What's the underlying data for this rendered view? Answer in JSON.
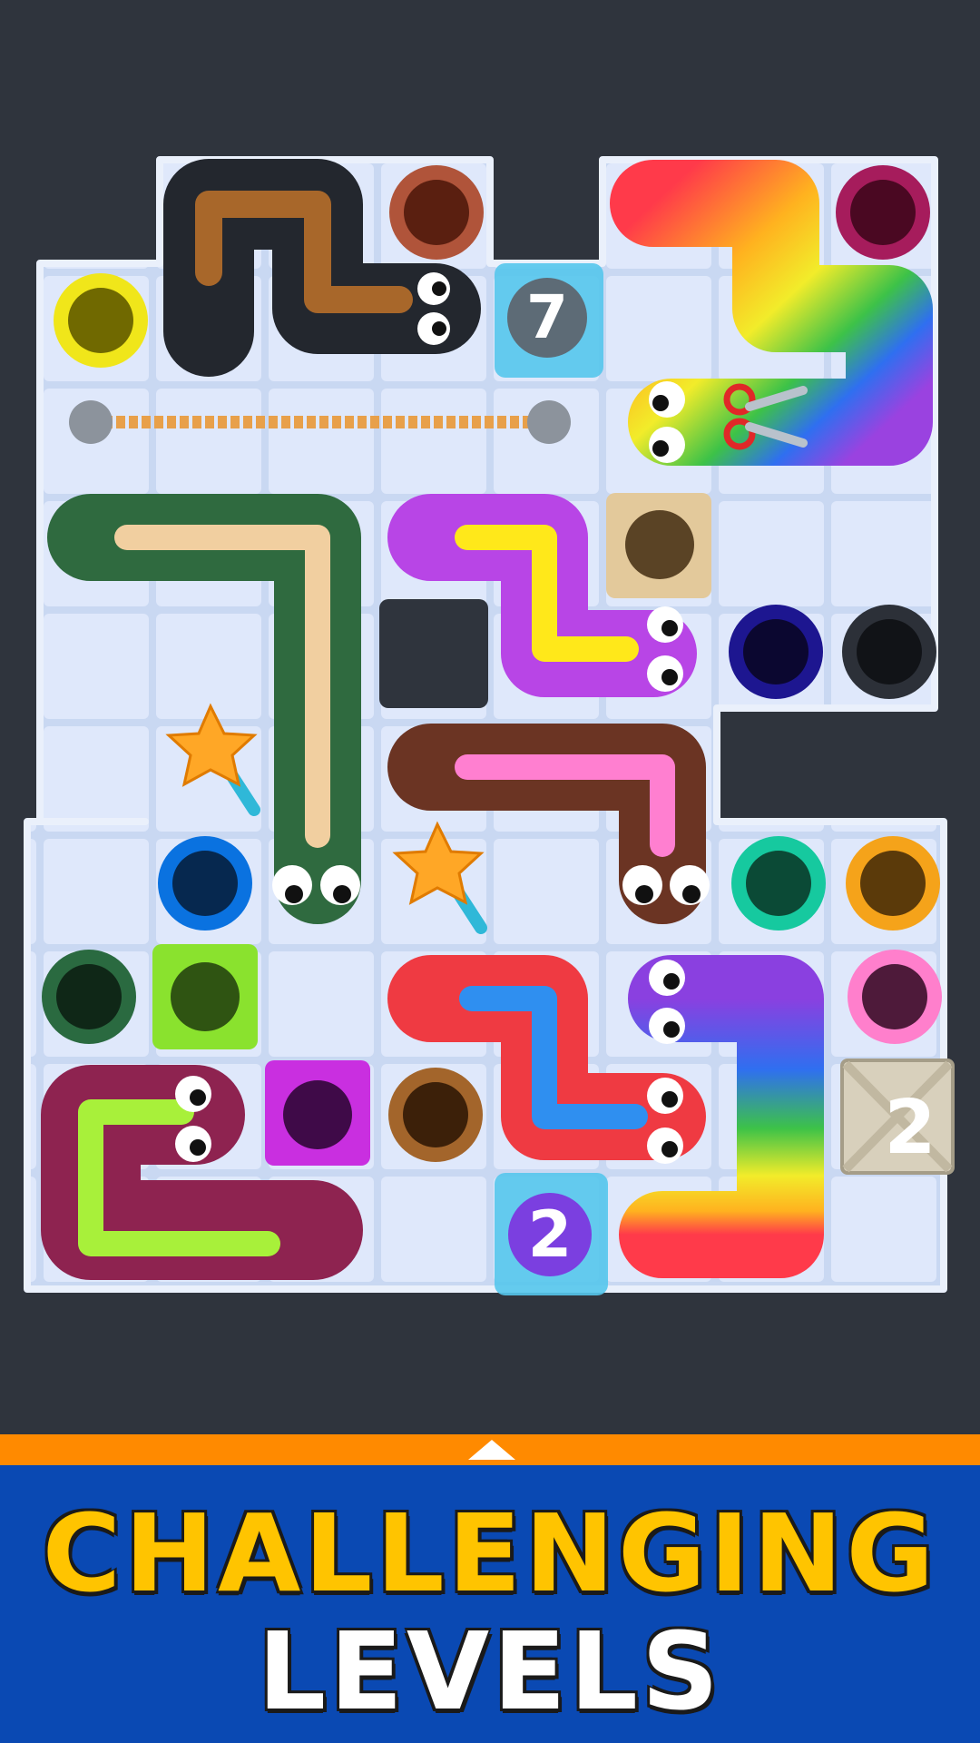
{
  "board": {
    "rope_color": "#e8a04a",
    "lock_tile_top": {
      "count": "7",
      "color": "#4fc3e8"
    },
    "lock_tile_bottom": {
      "count": "2",
      "color": "#4fc3e8"
    },
    "crate": {
      "count": "2",
      "color": "#d8d0bc"
    },
    "items": [
      "magic-wand-icon",
      "magic-wand-icon",
      "scissors-icon"
    ],
    "snakes": [
      {
        "name": "black-snake",
        "body": "#23272e",
        "stripe": "#a8672a"
      },
      {
        "name": "rainbow-snake-top",
        "body": "rainbow",
        "stripe": "none"
      },
      {
        "name": "green-snake",
        "body": "#2f6a3f",
        "stripe": "#f1cfa0"
      },
      {
        "name": "purple-snake",
        "body": "#b845e6",
        "stripe": "#ffe81a"
      },
      {
        "name": "brown-snake",
        "body": "#6b3423",
        "stripe": "#ff7fd0"
      },
      {
        "name": "red-snake",
        "body": "#ef3a42",
        "stripe": "#2f8ff0"
      },
      {
        "name": "rainbow-snake-bottom",
        "body": "rainbow",
        "stripe": "none"
      },
      {
        "name": "maroon-snake",
        "body": "#8e2350",
        "stripe": "#a8f03a"
      }
    ],
    "holes": [
      "#7a2f1d",
      "#7b1040",
      "#e9e21a",
      "#1b1d28",
      "#140e5a",
      "#1e2228",
      "#0a66d0",
      "#15b895",
      "#f39a14",
      "#1f5c35",
      "#84d82c",
      "#c326d6",
      "#8b5a2b",
      "#ff6fc4"
    ]
  },
  "banner": {
    "line1": "CHALLENGING",
    "line2": "LEVELS",
    "stripe_color": "#ff8a00",
    "bg_color": "#0a49b3"
  }
}
